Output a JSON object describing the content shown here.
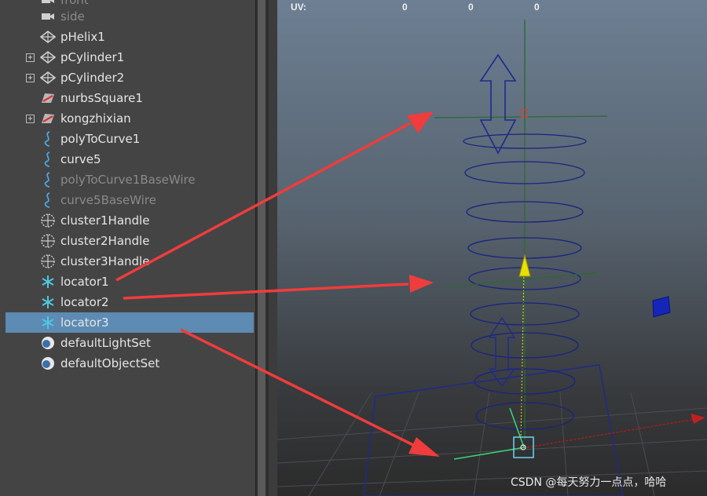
{
  "outliner": {
    "top_cut_label": "front",
    "items": [
      {
        "label": "side",
        "icon": "camera-icon",
        "expandable": false,
        "dim": true
      },
      {
        "label": "pHelix1",
        "icon": "mesh-icon",
        "expandable": false,
        "dim": false
      },
      {
        "label": "pCylinder1",
        "icon": "mesh-icon",
        "expandable": true,
        "dim": false
      },
      {
        "label": "pCylinder2",
        "icon": "mesh-icon",
        "expandable": true,
        "dim": false
      },
      {
        "label": "nurbsSquare1",
        "icon": "nurbs-curve-icon",
        "expandable": false,
        "dim": false
      },
      {
        "label": "kongzhixian",
        "icon": "nurbs-curve-icon",
        "expandable": true,
        "dim": false
      },
      {
        "label": "polyToCurve1",
        "icon": "curve-icon",
        "expandable": false,
        "dim": false
      },
      {
        "label": "curve5",
        "icon": "curve-icon",
        "expandable": false,
        "dim": false
      },
      {
        "label": "polyToCurve1BaseWire",
        "icon": "curve-icon",
        "expandable": false,
        "dim": true
      },
      {
        "label": "curve5BaseWire",
        "icon": "curve-icon",
        "expandable": false,
        "dim": true
      },
      {
        "label": "cluster1Handle",
        "icon": "cluster-icon",
        "expandable": false,
        "dim": false
      },
      {
        "label": "cluster2Handle",
        "icon": "cluster-icon",
        "expandable": false,
        "dim": false
      },
      {
        "label": "cluster3Handle",
        "icon": "cluster-icon",
        "expandable": false,
        "dim": false
      },
      {
        "label": "locator1",
        "icon": "locator-icon",
        "expandable": false,
        "dim": false
      },
      {
        "label": "locator2",
        "icon": "locator-icon",
        "expandable": false,
        "dim": false
      },
      {
        "label": "locator3",
        "icon": "locator-icon",
        "expandable": false,
        "dim": false,
        "selected": true
      },
      {
        "label": "defaultLightSet",
        "icon": "set-icon",
        "expandable": false,
        "dim": false
      },
      {
        "label": "defaultObjectSet",
        "icon": "set-icon",
        "expandable": false,
        "dim": false
      }
    ],
    "expand_glyph": "+"
  },
  "viewport": {
    "uv_label": "UV:",
    "uv_values": [
      "0",
      "0",
      "0"
    ],
    "helix_color": "#1a237e",
    "annotation_arrow_color": "#f03c3c"
  },
  "watermark": "CSDN @每天努力一点点，哈哈"
}
